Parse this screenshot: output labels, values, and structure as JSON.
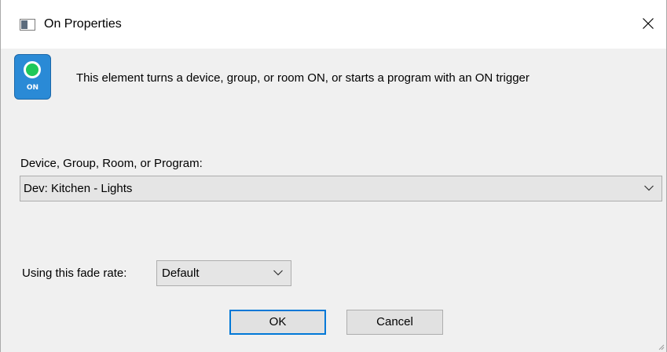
{
  "window": {
    "title": "On Properties",
    "close_icon": "close-icon"
  },
  "header": {
    "icon": "on-element-icon",
    "icon_label": "ON",
    "description": "This element turns a device, group, or room ON, or starts a program with an ON trigger"
  },
  "device": {
    "label": "Device, Group, Room, or Program:",
    "selected": "Dev: Kitchen - Lights"
  },
  "fade": {
    "label": "Using this fade rate:",
    "selected": "Default"
  },
  "buttons": {
    "ok_label": "OK",
    "cancel_label": "Cancel"
  },
  "colors": {
    "accent": "#0078d7",
    "icon_bg": "#2a8ad6",
    "lamp_green": "#1ec85a",
    "dialog_bg": "#f0f0f0"
  }
}
